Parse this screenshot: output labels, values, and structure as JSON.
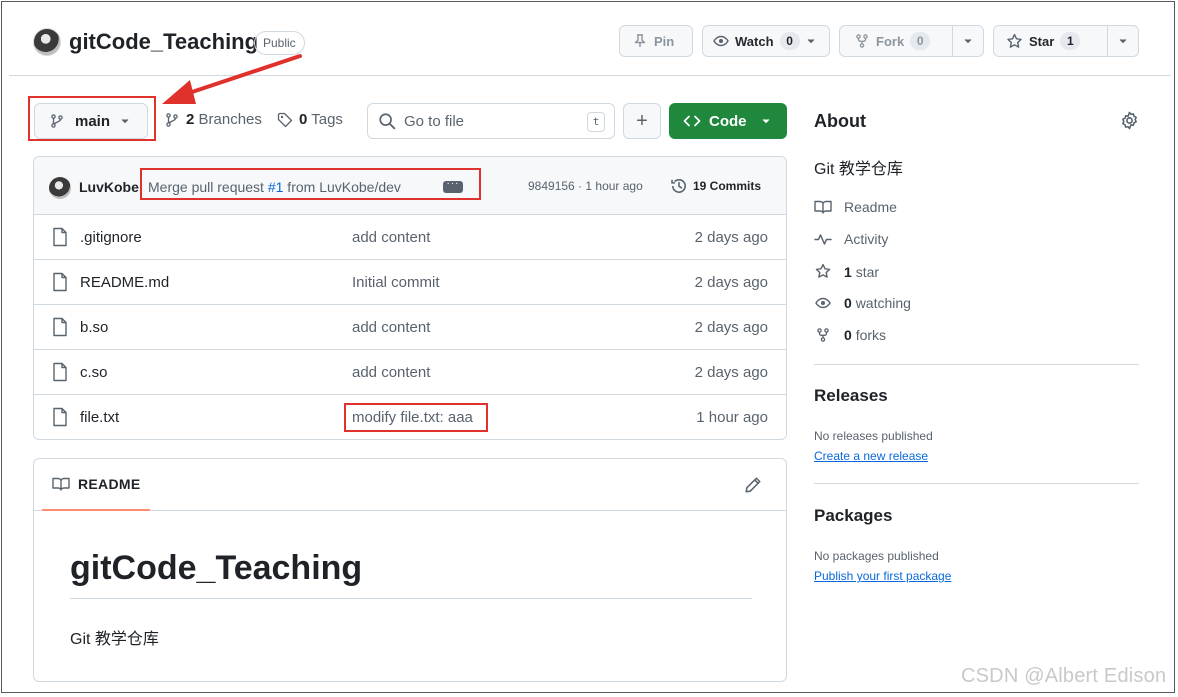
{
  "repo": {
    "name": "gitCode_Teaching",
    "visibility": "Public"
  },
  "header": {
    "pin_label": "Pin",
    "watch_label": "Watch",
    "watch_count": "0",
    "fork_label": "Fork",
    "fork_count": "0",
    "star_label": "Star",
    "star_count": "1"
  },
  "toolbar": {
    "branch": "main",
    "branches_count": "2",
    "branches_label": "Branches",
    "tags_count": "0",
    "tags_label": "Tags",
    "goto_placeholder": "Go to file",
    "goto_shortcut": "t",
    "add_label": "+",
    "code_label": "Code"
  },
  "latest_commit": {
    "author": "LuvKobe",
    "message_prefix": "Merge pull request ",
    "pr_link": "#1",
    "message_suffix": " from LuvKobe/dev",
    "sha_time": "9849156 · 1 hour ago",
    "commits_label": "19 Commits"
  },
  "files": [
    {
      "name": ".gitignore",
      "message": "add content",
      "date": "2 days ago"
    },
    {
      "name": "README.md",
      "message": "Initial commit",
      "date": "2 days ago"
    },
    {
      "name": "b.so",
      "message": "add content",
      "date": "2 days ago"
    },
    {
      "name": "c.so",
      "message": "add content",
      "date": "2 days ago"
    },
    {
      "name": "file.txt",
      "message": "modify file.txt: aaa",
      "date": "1 hour ago"
    }
  ],
  "readme": {
    "tab_label": "README",
    "title": "gitCode_Teaching",
    "body": "Git 教学仓库"
  },
  "about": {
    "title": "About",
    "description": "Git 教学仓库",
    "readme_label": "Readme",
    "activity_label": "Activity",
    "stars_count": "1",
    "stars_label": "star",
    "watching_count": "0",
    "watching_label": "watching",
    "forks_count": "0",
    "forks_label": "forks"
  },
  "releases": {
    "title": "Releases",
    "empty_text": "No releases published",
    "create_link": "Create a new release"
  },
  "packages": {
    "title": "Packages",
    "empty_text": "No packages published",
    "publish_link": "Publish your first package"
  },
  "watermark": "CSDN @Albert Edison",
  "colors": {
    "accent_green": "#1f883d",
    "link_blue": "#0969da",
    "annotation_red": "#e0322d",
    "readme_tab_underline": "#fd8c73"
  },
  "icons": [
    "pin-icon",
    "eye-icon",
    "fork-icon",
    "star-icon",
    "branch-icon",
    "tag-icon",
    "search-icon",
    "code-icon",
    "history-icon",
    "file-icon",
    "book-icon",
    "pencil-icon",
    "gear-icon",
    "pulse-icon"
  ]
}
